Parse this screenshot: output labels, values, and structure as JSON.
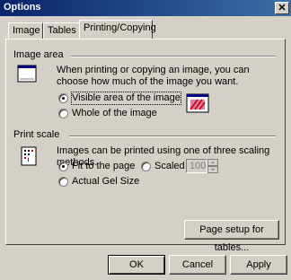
{
  "window": {
    "title": "Options",
    "close_glyph": "✕"
  },
  "tabs": [
    {
      "label": "Image"
    },
    {
      "label": "Tables"
    },
    {
      "label": "Printing/Copying"
    }
  ],
  "image_area": {
    "heading": "Image area",
    "description": "When printing or copying an image, you can choose how much of the image you want.",
    "options": [
      {
        "label": "Visible area of the image",
        "selected": true
      },
      {
        "label": "Whole of the image",
        "selected": false
      }
    ]
  },
  "print_scale": {
    "heading": "Print scale",
    "description": "Images can be printed using one of three scaling methods.",
    "options": [
      {
        "label": "Fit to the page",
        "selected": true
      },
      {
        "label": "Scaled",
        "selected": false
      },
      {
        "label": "Actual Gel Size",
        "selected": false
      }
    ],
    "scaled_value": "100"
  },
  "page_setup_button": "Page setup for tables...",
  "footer": {
    "ok": "OK",
    "cancel": "Cancel",
    "apply": "Apply"
  }
}
